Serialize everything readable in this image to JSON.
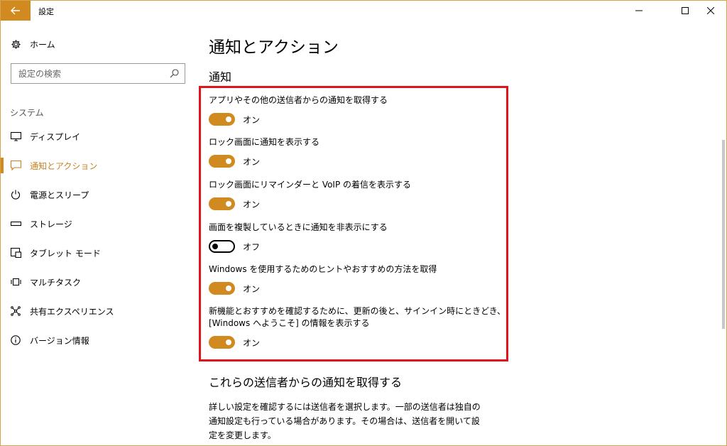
{
  "window": {
    "title": "設定"
  },
  "sidebar": {
    "home_label": "ホーム",
    "search_placeholder": "設定の検索",
    "section_label": "システム",
    "items": [
      {
        "label": "ディスプレイ",
        "icon": "monitor-icon",
        "active": false
      },
      {
        "label": "通知とアクション",
        "icon": "notification-icon",
        "active": true
      },
      {
        "label": "電源とスリープ",
        "icon": "power-icon",
        "active": false
      },
      {
        "label": "ストレージ",
        "icon": "storage-icon",
        "active": false
      },
      {
        "label": "タブレット モード",
        "icon": "tablet-icon",
        "active": false
      },
      {
        "label": "マルチタスク",
        "icon": "multitask-icon",
        "active": false
      },
      {
        "label": "共有エクスペリエンス",
        "icon": "share-icon",
        "active": false
      },
      {
        "label": "バージョン情報",
        "icon": "info-icon",
        "active": false
      }
    ]
  },
  "main": {
    "title": "通知とアクション",
    "notifications_heading": "通知",
    "settings": [
      {
        "label": "アプリやその他の送信者からの通知を取得する",
        "state": "オン",
        "on": true
      },
      {
        "label": "ロック画面に通知を表示する",
        "state": "オン",
        "on": true
      },
      {
        "label": "ロック画面にリマインダーと VoIP の着信を表示する",
        "state": "オン",
        "on": true
      },
      {
        "label": "画面を複製しているときに通知を非表示にする",
        "state": "オフ",
        "on": false
      },
      {
        "label": "Windows を使用するためのヒントやおすすめの方法を取得",
        "state": "オン",
        "on": true
      },
      {
        "label_line1": "新機能とおすすめを確認するために、更新の後と、サインイン時にときどき、",
        "label_line2": "[Windows へようこそ] の情報を表示する",
        "state": "オン",
        "on": true
      }
    ],
    "senders_heading": "これらの送信者からの通知を取得する",
    "senders_description": "詳しい設定を確認するには送信者を選択します。一部の送信者は独自の通知設定も行っている場合があります。その場合は、送信者を開いて設定を変更します。"
  },
  "colors": {
    "accent": "#d08a1f",
    "highlight_border": "#e0121b"
  }
}
